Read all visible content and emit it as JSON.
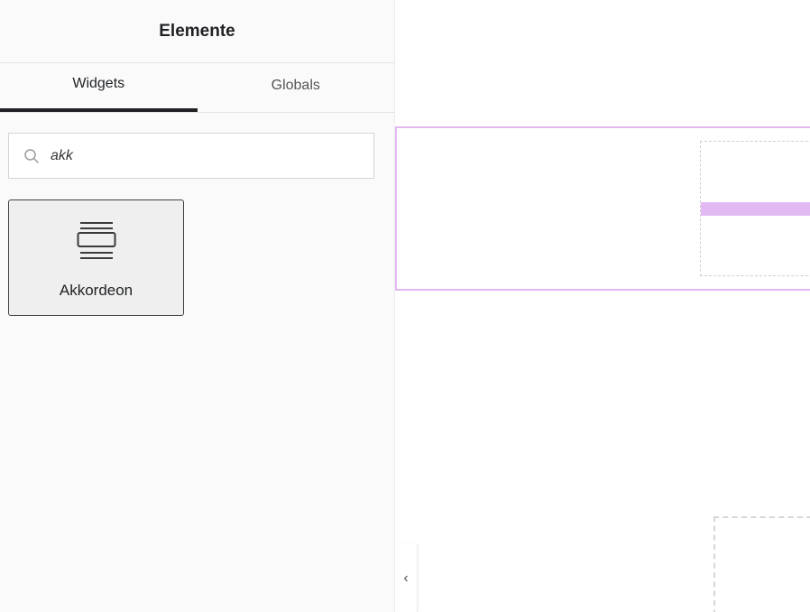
{
  "panel": {
    "title": "Elemente",
    "tabs": [
      {
        "label": "Widgets",
        "active": true
      },
      {
        "label": "Globals",
        "active": false
      }
    ],
    "search": {
      "value": "akk",
      "icon": "search-icon"
    },
    "results": [
      {
        "label": "Akkordeon",
        "icon": "accordion-icon"
      }
    ]
  },
  "canvas": {
    "collapse_toggle_glyph": "‹",
    "accent_color": "#e3b9f3"
  }
}
